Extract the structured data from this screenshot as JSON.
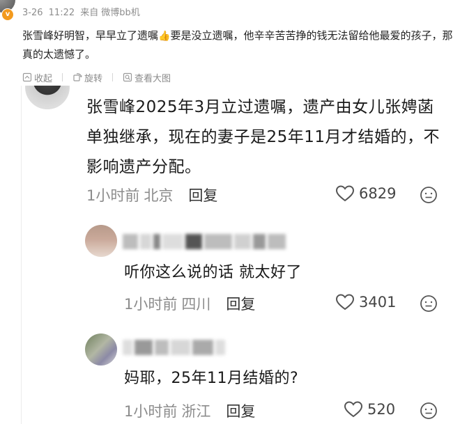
{
  "post": {
    "date": "3-26",
    "time": "11:22",
    "source_prefix": "来自",
    "source_name": "微博bb机",
    "vip_badge": "v",
    "text_before_emoji": "张雪峰好明智，早早立了遗嘱",
    "emoji": "👍",
    "text_after_emoji": "要是没立遗嘱，他辛辛苦苦挣的钱无法留给他最爱的孩子，那真的太遗憾了。",
    "actions": [
      {
        "label": "收起",
        "icon": "collapse-icon"
      },
      {
        "label": "旋转",
        "icon": "rotate-icon"
      },
      {
        "label": "查看大图",
        "icon": "zoom-icon"
      }
    ]
  },
  "screenshot": {
    "main_comment": {
      "text": "张雪峰2025年3月立过遗嘱，遗产由女儿张娉菡单独继承，现在的妻子是25年11月才结婚的，不影响遗产分配。",
      "time": "1小时前",
      "location": "北京",
      "reply_label": "回复",
      "likes": "6829"
    },
    "replies": [
      {
        "text": "听你这么说的话 就太好了",
        "time": "1小时前",
        "location": "四川",
        "reply_label": "回复",
        "likes": "3401"
      },
      {
        "text": "妈耶，25年11月结婚的?",
        "time": "1小时前",
        "location": "浙江",
        "reply_label": "回复",
        "likes": "520"
      }
    ]
  },
  "colors": {
    "meta_gray": "#8d8d8d",
    "vip_orange": "#f39a1e",
    "text_dark": "#1a1a1a"
  }
}
